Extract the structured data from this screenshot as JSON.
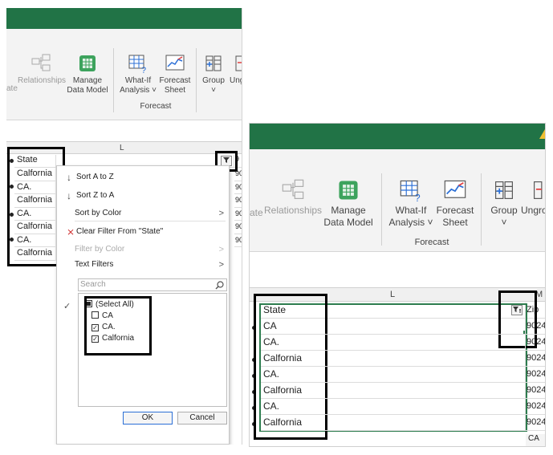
{
  "ribbon": {
    "relationships_prefix": "ate",
    "relationships_label": "Relationships",
    "manage_line1": "Manage",
    "manage_line2": "Data Model",
    "whatif_line1": "What-If",
    "whatif_line2": "Analysis ˅",
    "forecast_line1": "Forecast",
    "forecast_line2": "Sheet",
    "group_label": "Group",
    "group_caret": "˅",
    "ungroup_label": "Ungro",
    "forecast_group_label": "Forecast"
  },
  "left": {
    "column_letter": "L",
    "header": "State",
    "rows": [
      "Calfornia",
      "CA.",
      "Calfornia",
      "CA.",
      "Calfornia",
      "CA.",
      "Calfornia"
    ],
    "zip_partial": [
      "9",
      "90",
      "90",
      "90",
      "90",
      "90",
      "90"
    ]
  },
  "filter_menu": {
    "sort_az": "Sort A to Z",
    "sort_za": "Sort Z to A",
    "sort_by_color": "Sort by Color",
    "clear_filter": "Clear Filter From \"State\"",
    "filter_by_color": "Filter by Color",
    "text_filters": "Text Filters",
    "search_placeholder": "Search",
    "items": [
      "(Select All)",
      "CA",
      "CA.",
      "Calfornia"
    ],
    "ok": "OK",
    "cancel": "Cancel"
  },
  "right": {
    "column_letter": "L",
    "next_column_letter": "M",
    "header": "State",
    "zip_header": "Zip",
    "rows": [
      "CA",
      "CA.",
      "Calfornia",
      "CA.",
      "Calfornia",
      "CA.",
      "Calfornia"
    ],
    "zip_values": [
      "9024",
      "9024",
      "9024",
      "9024",
      "9024",
      "9024",
      "9024"
    ],
    "bottom_partial": "CA"
  },
  "colors": {
    "excel_green": "#217346",
    "selection_green": "#2e7d4f"
  }
}
